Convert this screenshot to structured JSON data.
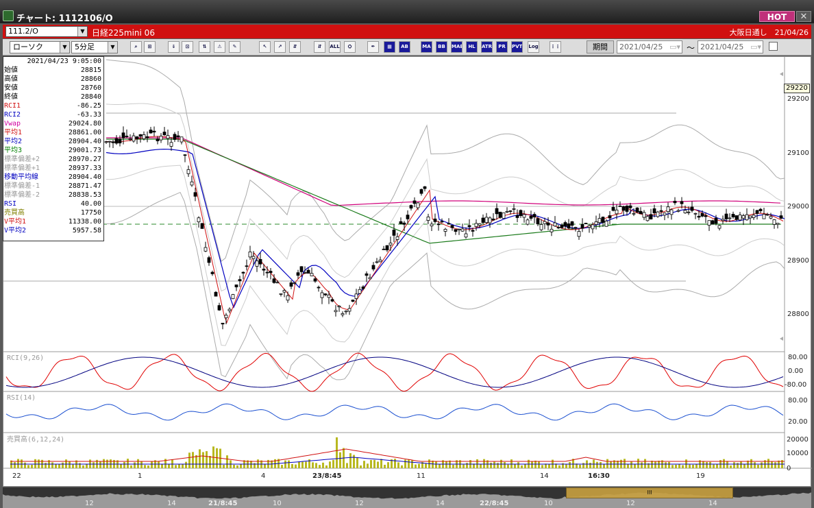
{
  "window": {
    "title": "チャート: 1112106/O",
    "hot": "HOT",
    "close": "✕",
    "app_icon": "chart-app-icon"
  },
  "symbol_bar": {
    "symbol": "111.2/O",
    "name": "日経225mini 06",
    "right": "大阪日通し　21/04/26",
    "bg": "#d01010"
  },
  "toolbar": {
    "chart_type": "ローソク",
    "interval": "5分足",
    "period_label": "期間",
    "date_from": "2021/04/25",
    "tilde": "〜",
    "date_to": "2021/04/25",
    "tools": [
      "⌕",
      "⊞",
      "⇓",
      "⊡",
      "⇅",
      "⚠",
      "✎",
      "↖",
      "↗",
      "⇵",
      "⇵",
      "ALL",
      "⛭",
      "✒",
      "▦",
      "AB",
      "MA",
      "BB",
      "MAE",
      "HL",
      "ATR",
      "PR",
      "PVT",
      "Log",
      "⋮⋮"
    ]
  },
  "info": {
    "datetime": "2021/04/23  9:05:00",
    "rows": [
      {
        "label": "始値",
        "value": "28815",
        "color": "#000"
      },
      {
        "label": "高値",
        "value": "28860",
        "color": "#000"
      },
      {
        "label": "安値",
        "value": "28760",
        "color": "#000"
      },
      {
        "label": "終値",
        "value": "28840",
        "color": "#000"
      },
      {
        "label": "RCI1",
        "value": "-86.25",
        "color": "#d01010"
      },
      {
        "label": "RCI2",
        "value": "-63.33",
        "color": "#0000c0"
      },
      {
        "label": "Vwap",
        "value": "29024.80",
        "color": "#d000a0"
      },
      {
        "label": "平均1",
        "value": "28861.00",
        "color": "#d01010"
      },
      {
        "label": "平均2",
        "value": "28904.40",
        "color": "#0000c0"
      },
      {
        "label": "平均3",
        "value": "29001.73",
        "color": "#008000"
      },
      {
        "label": "標準偏差+2",
        "value": "28970.27",
        "color": "#999"
      },
      {
        "label": "標準偏差+1",
        "value": "28937.33",
        "color": "#999"
      },
      {
        "label": "移動平均線",
        "value": "28904.40",
        "color": "#0000c0"
      },
      {
        "label": "標準偏差-1",
        "value": "28871.47",
        "color": "#999"
      },
      {
        "label": "標準偏差-2",
        "value": "28838.53",
        "color": "#999"
      },
      {
        "label": "RSI",
        "value": "40.00",
        "color": "#0000c0"
      },
      {
        "label": "売買高",
        "value": "17750",
        "color": "#808000"
      },
      {
        "label": "V平均1",
        "value": "11338.00",
        "color": "#d01010"
      },
      {
        "label": "V平均2",
        "value": "5957.58",
        "color": "#0000c0"
      }
    ]
  },
  "price_axis": {
    "current": "29220",
    "ticks": [
      "29200",
      "29100",
      "29000",
      "28900",
      "28800"
    ]
  },
  "panels": {
    "rci": {
      "label": "RCI(9,26)",
      "ticks": [
        "80.00",
        "0.00",
        "-80.00"
      ]
    },
    "rsi": {
      "label": "RSI(14)",
      "ticks": [
        "80.00",
        "20.00"
      ]
    },
    "vol": {
      "label": "売買高(6,12,24)",
      "ticks": [
        "20000",
        "10000",
        "0"
      ]
    }
  },
  "x_axis": [
    "22",
    "1",
    "4",
    "23/8:45",
    "11",
    "14",
    "16:30",
    "19"
  ],
  "navigator": {
    "labels": [
      "12",
      "14",
      "21/8:45",
      "10",
      "12",
      "14",
      "22/8:45",
      "10",
      "12",
      "14"
    ],
    "thumb": "III"
  },
  "colors": {
    "accent": "#d01010",
    "rci_fast": "#e00000",
    "rci_slow": "#000080",
    "rsi": "#1a4fd0",
    "volume": "#b8b820"
  }
}
